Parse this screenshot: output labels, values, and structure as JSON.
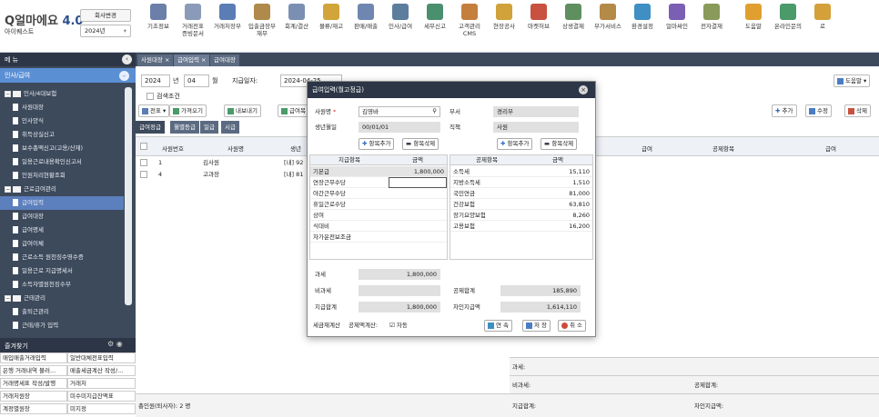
{
  "app": {
    "logo_text": "얼마에요",
    "logo_version": "4.0",
    "company_name": "아이퀘스트",
    "company_change": "회사변경",
    "year": "2024년"
  },
  "top_menu": [
    {
      "label": "기초정보",
      "icon": "basic-info-icon",
      "color": "#6b7fa8"
    },
    {
      "label": "거래전표\n증빙문서",
      "icon": "voucher-icon",
      "color": "#8a9bb9"
    },
    {
      "label": "거래처장부",
      "icon": "ledger-icon",
      "color": "#5a7db5"
    },
    {
      "label": "입출금장부\n재무",
      "icon": "money-bag-icon",
      "color": "#b08a4a"
    },
    {
      "label": "회계/결산",
      "icon": "calculator-icon",
      "color": "#7a8fb1"
    },
    {
      "label": "물류/재고",
      "icon": "truck-icon",
      "color": "#d1a53a"
    },
    {
      "label": "판매/매출",
      "icon": "sales-icon",
      "color": "#6f86b0"
    },
    {
      "label": "인사/급여",
      "icon": "person-icon",
      "color": "#5d7d9e"
    },
    {
      "label": "세무신고",
      "icon": "tax-icon",
      "color": "#4a8f6e"
    },
    {
      "label": "고객관리\nCMS",
      "icon": "customer-icon",
      "color": "#c47f3d"
    },
    {
      "label": "현장공사",
      "icon": "construction-icon",
      "color": "#cfa23a"
    },
    {
      "label": "마켓허브",
      "icon": "market-icon",
      "color": "#c9513f"
    },
    {
      "label": "상생결제",
      "icon": "payment-icon",
      "color": "#5f8f5f"
    },
    {
      "label": "부가서비스",
      "icon": "service-icon",
      "color": "#b38a48"
    },
    {
      "label": "환경설정",
      "icon": "settings-icon",
      "color": "#3f8fc4"
    },
    {
      "label": "얼마싸인",
      "icon": "signature-icon",
      "color": "#7a5fb5"
    },
    {
      "label": "전자결재",
      "icon": "approval-icon",
      "color": "#8a9a5b"
    },
    {
      "label": "도움말",
      "icon": "help-icon",
      "color": "#e0a030"
    },
    {
      "label": "온라인문의",
      "icon": "inquiry-icon",
      "color": "#4a9a6a"
    },
    {
      "label": "로",
      "icon": "more-icon",
      "color": "#d4a03a"
    }
  ],
  "nav": {
    "header": "메 뉴",
    "section": "인사/급여",
    "items": [
      {
        "label": "인사/4대보험",
        "type": "folder"
      },
      {
        "label": "사원대장",
        "type": "doc"
      },
      {
        "label": "인사양식",
        "type": "doc"
      },
      {
        "label": "취득상실신고",
        "type": "doc"
      },
      {
        "label": "보수총액신고(고용/산재)",
        "type": "doc"
      },
      {
        "label": "일용근로내용확인신고서",
        "type": "doc"
      },
      {
        "label": "인원처리현황조회",
        "type": "doc"
      },
      {
        "label": "근로급여관리",
        "type": "folder"
      },
      {
        "label": "급여입력",
        "type": "doc",
        "selected": true
      },
      {
        "label": "급여대장",
        "type": "doc"
      },
      {
        "label": "급여명세",
        "type": "doc"
      },
      {
        "label": "급여이체",
        "type": "doc"
      },
      {
        "label": "근로소득 원천징수영수증",
        "type": "doc"
      },
      {
        "label": "일용근로 지급명세서",
        "type": "doc"
      },
      {
        "label": "소득자별원천징수부",
        "type": "doc"
      },
      {
        "label": "근태관리",
        "type": "folder"
      },
      {
        "label": "출퇴근관리",
        "type": "doc"
      },
      {
        "label": "근태/휴가 입력",
        "type": "doc"
      }
    ],
    "favorites_header": "즐겨찾기",
    "favorites": [
      [
        "매입매출거래입력",
        "일반대체전표입력"
      ],
      [
        "은행 거래내역 불러...",
        "매출세금계산 작성/..."
      ],
      [
        "거래명세표 작성/발행",
        "거래처"
      ],
      [
        "거래처원장",
        "미수미지급잔액표"
      ],
      [
        "계정별원장",
        "미지정"
      ]
    ]
  },
  "tabs": [
    "사원대장",
    "급여입력",
    "급여대장"
  ],
  "filter": {
    "year": "2024",
    "year_unit": "년",
    "month": "04",
    "month_unit": "월",
    "pay_date_label": "지급일자:",
    "pay_date": "2024-04-25",
    "search_cond": "검색조건",
    "help": "도움말"
  },
  "toolbar": {
    "slip": "전표",
    "import": "가져오기",
    "export": "내보내기",
    "payslip": "급여복",
    "add": "추가",
    "edit": "수정",
    "delete": "삭제"
  },
  "subtabs": [
    "급여정급",
    "월별등급",
    "일급",
    "시급"
  ],
  "grid": {
    "headers": [
      "사원번호",
      "사원명",
      "생년",
      "급여",
      "공제항목",
      "급여"
    ],
    "rows": [
      {
        "no": "1",
        "name": "김사원",
        "birth": "[내] 92"
      },
      {
        "no": "4",
        "name": "고과장",
        "birth": "[내] 81"
      }
    ]
  },
  "summary": {
    "tax": "과세:",
    "nontax": "비과세:",
    "total_pay": "지급합계:",
    "total_deduct": "공제합계:",
    "net_pay": "차인지급액:"
  },
  "footer_count": "총인원(퇴사자):    2 명",
  "modal": {
    "title": "급여입력(월고정급)",
    "emp_label": "사원명",
    "emp_value": "김영바",
    "dept_label": "부서",
    "dept_value": "경리부",
    "birth_label": "생년월일",
    "birth_value": "00/01/01",
    "position_label": "직책",
    "position_value": "사원",
    "add_item": "항목추가",
    "del_item": "항목삭제",
    "pay_headers": [
      "지급항목",
      "금액"
    ],
    "pay_items": [
      {
        "name": "기본급",
        "amount": "1,800,000"
      },
      {
        "name": "연장근무수당",
        "amount": ""
      },
      {
        "name": "야간근무수당",
        "amount": ""
      },
      {
        "name": "휴일근로수당",
        "amount": ""
      },
      {
        "name": "상여",
        "amount": ""
      },
      {
        "name": "식대비",
        "amount": ""
      },
      {
        "name": "자가운전보조금",
        "amount": ""
      }
    ],
    "deduct_headers": [
      "공제항목",
      "금액"
    ],
    "deduct_items": [
      {
        "name": "소득세",
        "amount": "15,110"
      },
      {
        "name": "지방소득세",
        "amount": "1,510"
      },
      {
        "name": "국민연금",
        "amount": "81,000"
      },
      {
        "name": "건강보험",
        "amount": "63,810"
      },
      {
        "name": "장기요양보험",
        "amount": "8,260"
      },
      {
        "name": "고용보험",
        "amount": "16,200"
      }
    ],
    "tax_label": "과세",
    "tax_value": "1,800,000",
    "nontax_label": "비과세",
    "nontax_value": "",
    "deduct_total_label": "공제합계",
    "deduct_total_value": "185,890",
    "pay_total_label": "지급합계",
    "pay_total_value": "1,800,000",
    "net_label": "차인지급액",
    "net_value": "1,614,110",
    "tax_calc_label": "세금재계산",
    "deduct_calc_label": "공제액계산:",
    "auto_label": "자동",
    "continue": "연 속",
    "save": "저 장",
    "cancel": "취 소"
  }
}
